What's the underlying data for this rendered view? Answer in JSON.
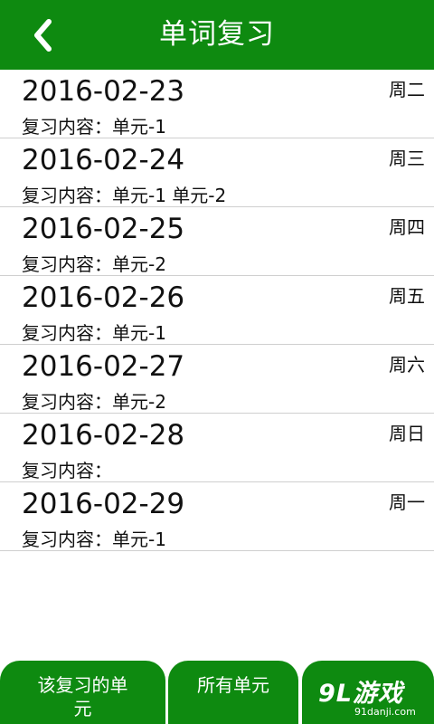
{
  "header": {
    "title": "单词复习",
    "back_icon": "chevron-left-icon"
  },
  "colors": {
    "primary": "#0e8a10",
    "text": "#111111",
    "divider": "#cfcfcf"
  },
  "reviews": [
    {
      "date": "2016-02-23",
      "content": "复习内容：单元-1",
      "weekday": "周二"
    },
    {
      "date": "2016-02-24",
      "content": "复习内容：单元-1 单元-2",
      "weekday": "周三"
    },
    {
      "date": "2016-02-25",
      "content": "复习内容：单元-2",
      "weekday": "周四"
    },
    {
      "date": "2016-02-26",
      "content": "复习内容：单元-1",
      "weekday": "周五"
    },
    {
      "date": "2016-02-27",
      "content": "复习内容：单元-2",
      "weekday": "周六"
    },
    {
      "date": "2016-02-28",
      "content": "复习内容：",
      "weekday": "周日"
    },
    {
      "date": "2016-02-29",
      "content": "复习内容：单元-1",
      "weekday": "周一"
    }
  ],
  "tabs": [
    {
      "label": "该复习的单元"
    },
    {
      "label": "所有单元"
    },
    {
      "label": ""
    }
  ],
  "watermark": {
    "logo": "9L游戏",
    "url": "91danji.com"
  }
}
